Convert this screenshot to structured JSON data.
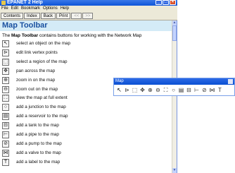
{
  "window": {
    "title": "EPANET 2 Help"
  },
  "menubar": [
    "File",
    "Edit",
    "Bookmark",
    "Options",
    "Help"
  ],
  "toolbar": [
    "Contents",
    "Index",
    "Back",
    "Print",
    "<<",
    ">>"
  ],
  "heading": "Map Toolbar",
  "intro": {
    "prefix": "The ",
    "bold": "Map Toolbar",
    "suffix": " contains buttons for working with the Network Map"
  },
  "tools": [
    {
      "icon": "↖",
      "icon_name": "select-object-icon",
      "desc": "select an object on the map"
    },
    {
      "icon": "⊳",
      "icon_name": "vertex-icon",
      "desc": "edit link vertex points"
    },
    {
      "icon": "⬚",
      "icon_name": "select-region-icon",
      "desc": "select a region of the map"
    },
    {
      "icon": "✥",
      "icon_name": "pan-icon",
      "desc": "pan across the map"
    },
    {
      "icon": "⊕",
      "icon_name": "zoom-in-icon",
      "desc": "zoom in on the map"
    },
    {
      "icon": "⊖",
      "icon_name": "zoom-out-icon",
      "desc": "zoom out on the map"
    },
    {
      "icon": "⛶",
      "icon_name": "full-extent-icon",
      "desc": "view the map at full extent"
    },
    {
      "icon": "○",
      "icon_name": "junction-icon",
      "desc": "add a junction to the map"
    },
    {
      "icon": "▤",
      "icon_name": "reservoir-icon",
      "desc": "add a reservoir to the map"
    },
    {
      "icon": "⊟",
      "icon_name": "tank-icon",
      "desc": "add a tank to the map"
    },
    {
      "icon": "⊢",
      "icon_name": "pipe-icon",
      "desc": "add a pipe to the map"
    },
    {
      "icon": "⊘",
      "icon_name": "pump-icon",
      "desc": "add a pump to the map"
    },
    {
      "icon": "⋈",
      "icon_name": "valve-icon",
      "desc": "add a valve to the map"
    },
    {
      "icon": "T",
      "icon_name": "label-icon",
      "desc": "add a label to the map"
    }
  ],
  "palette": {
    "title": "Map",
    "tools": [
      "↖",
      "⊳",
      "⬚",
      "✥",
      "⊕",
      "⊖",
      "⛶",
      "○",
      "▤",
      "⊟",
      "⊢",
      "⊘",
      "⋈",
      "T"
    ],
    "tool_names": [
      "select",
      "vertex",
      "region",
      "pan",
      "zoom-in",
      "zoom-out",
      "full-extent",
      "junction",
      "reservoir",
      "tank",
      "pipe",
      "pump",
      "valve",
      "label"
    ]
  },
  "colors": {
    "titlebar": "#0d54d8",
    "heading_band": "#d4ebf7",
    "heading_text": "#1a50a0"
  }
}
